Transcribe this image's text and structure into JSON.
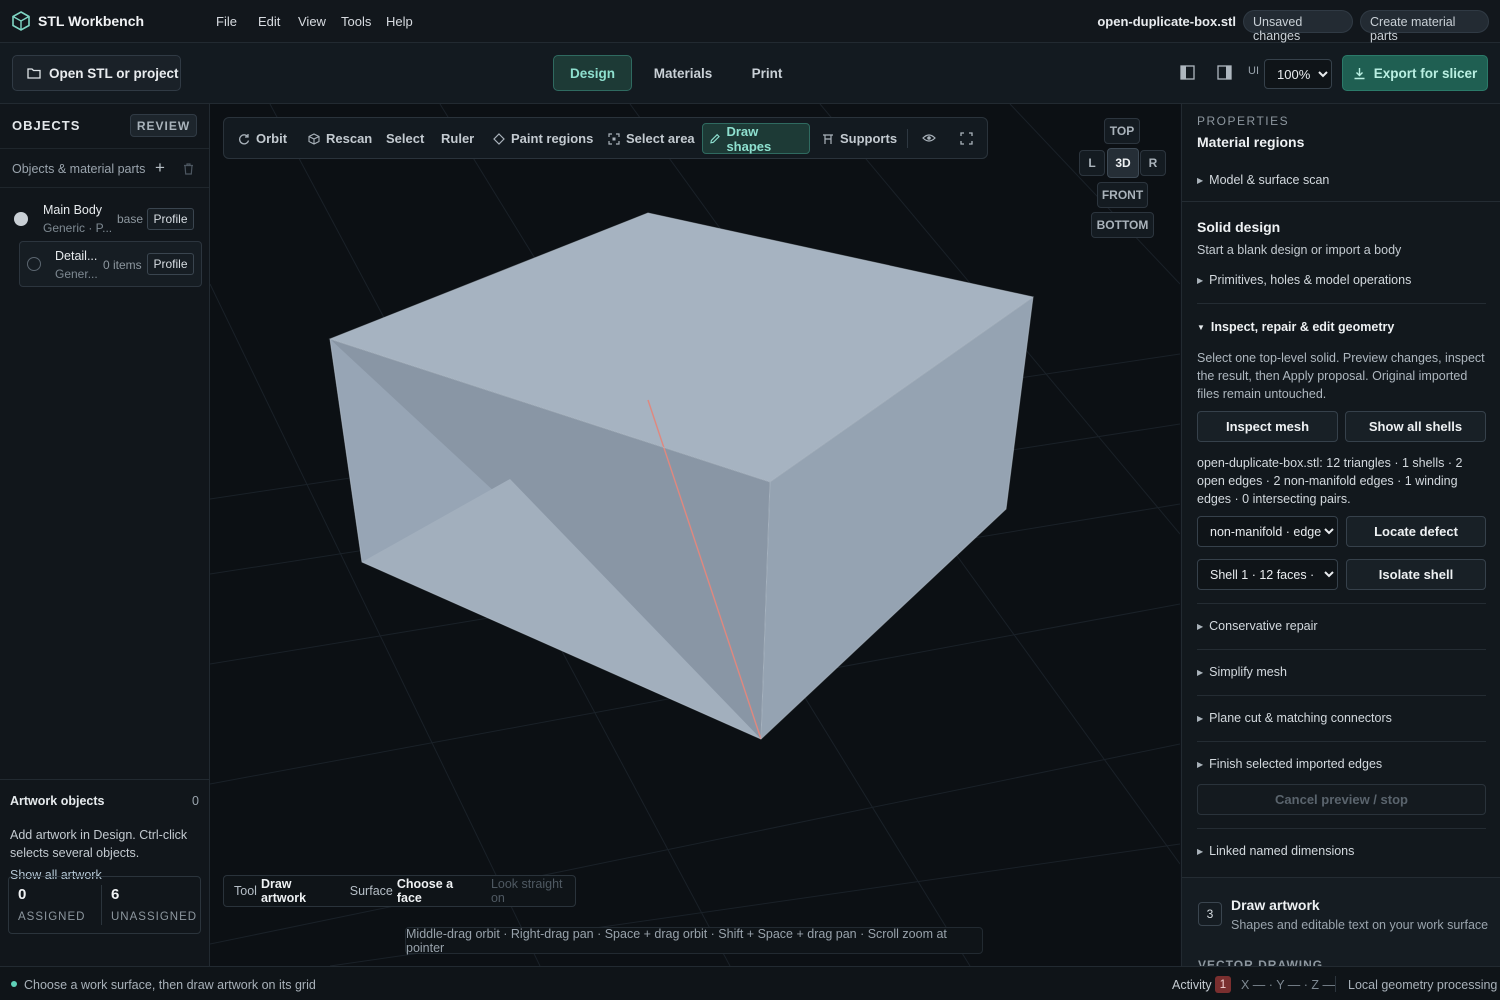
{
  "app": {
    "title": "STL Workbench"
  },
  "menu": [
    "File",
    "Edit",
    "View",
    "Tools",
    "Help"
  ],
  "header": {
    "filename": "open-duplicate-box.stl",
    "unsaved": "Unsaved changes",
    "create_parts": "Create material parts"
  },
  "toolbar": {
    "open_label": "Open STL or project",
    "modes": [
      "Design",
      "Materials",
      "Print"
    ],
    "active_mode": "Design",
    "ui_label": "UI",
    "zoom": "100%",
    "export_label": "Export for slicer"
  },
  "left": {
    "title": "OBJECTS",
    "review": "REVIEW",
    "parts_label": "Objects & material parts",
    "objects": [
      {
        "name": "Main Body",
        "sub": "Generic · P...",
        "tag": "base",
        "profile": "Profile"
      },
      {
        "name": "Detail...",
        "sub": "Gener...",
        "tag": "0 items",
        "profile": "Profile"
      }
    ],
    "artwork": {
      "title": "Artwork objects",
      "count": "0",
      "desc": "Add artwork in Design. Ctrl-click selects several objects.",
      "show_all": "Show all artwork",
      "assigned_value": "0",
      "assigned_label": "ASSIGNED",
      "unassigned_value": "6",
      "unassigned_label": "UNASSIGNED"
    }
  },
  "viewport": {
    "tools": [
      "Orbit",
      "Rescan",
      "Select",
      "Ruler",
      "Paint regions",
      "Select area",
      "Draw shapes",
      "Supports"
    ],
    "active_tool": "Draw shapes",
    "views": {
      "top": "TOP",
      "left": "L",
      "three_d": "3D",
      "right": "R",
      "front": "FRONT",
      "bottom": "BOTTOM"
    },
    "status": {
      "tool_key": "Tool",
      "tool_val": "Draw artwork",
      "surface_key": "Surface",
      "surface_val": "Choose a face",
      "look": "Look straight on"
    },
    "hint": "Middle-drag orbit · Right-drag pan · Space + drag orbit · Shift + Space + drag pan · Scroll zoom at pointer"
  },
  "properties": {
    "eyebrow": "PROPERTIES",
    "title": "Material regions",
    "model_scan": "Model & surface scan",
    "solid_title": "Solid design",
    "solid_sub": "Start a blank design or import a body",
    "primitives": "Primitives, holes & model operations",
    "inspect_title": "Inspect, repair & edit geometry",
    "inspect_desc": "Select one top-level solid. Preview changes, inspect the result, then Apply proposal. Original imported files remain untouched.",
    "inspect_btn": "Inspect mesh",
    "shells_btn": "Show all shells",
    "report": "open-duplicate-box.stl: 12 triangles · 1 shells · 2 open edges · 2 non-manifold edges · 1 winding edges · 0 intersecting pairs.",
    "defect_select": "non-manifold · edge",
    "locate_btn": "Locate defect",
    "shell_select": "Shell 1 · 12 faces ·",
    "isolate_btn": "Isolate shell",
    "sections": [
      "Conservative repair",
      "Simplify mesh",
      "Plane cut & matching connectors",
      "Finish selected imported edges"
    ],
    "cancel_btn": "Cancel preview / stop",
    "linked": "Linked named dimensions",
    "step_num": "3",
    "draw_title": "Draw artwork",
    "draw_sub": "Shapes and editable text on your work surface",
    "vector_label": "VECTOR DRAWING"
  },
  "statusbar": {
    "message": "Choose a work surface, then draw artwork on its grid",
    "activity": "Activity",
    "activity_count": "1",
    "coords": "X — · Y — · Z —",
    "processing": "Local geometry processing"
  },
  "colors": {
    "accent": "#8ee0cf",
    "accent_bg": "#1d3a36",
    "export_bg": "#1f5f52",
    "badge": "#7a2f2f",
    "edge_highlight": "#e0887f"
  }
}
